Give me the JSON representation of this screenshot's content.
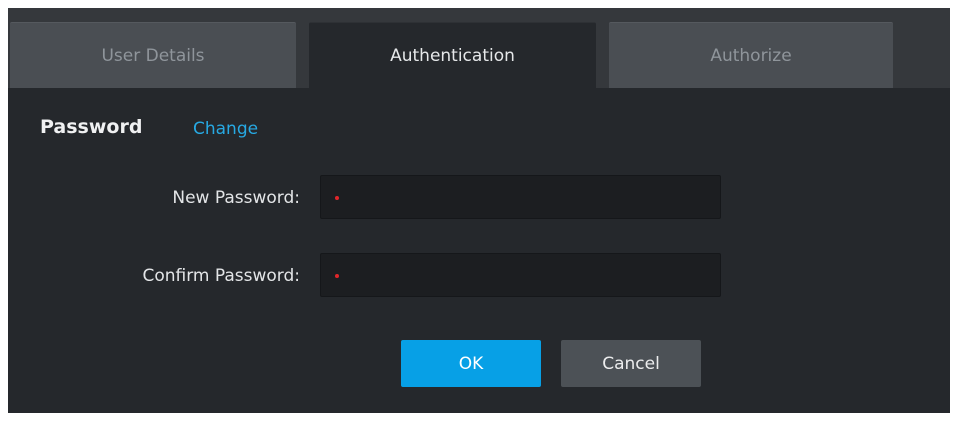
{
  "tabs": [
    {
      "label": "User Details",
      "active": false
    },
    {
      "label": "Authentication",
      "active": true
    },
    {
      "label": "Authorize",
      "active": false
    }
  ],
  "password_section": {
    "title": "Password",
    "change_link": "Change"
  },
  "fields": {
    "new_password": {
      "label": "New Password:",
      "value": "",
      "required": true
    },
    "confirm_password": {
      "label": "Confirm Password:",
      "value": "",
      "required": true
    }
  },
  "buttons": {
    "ok": "OK",
    "cancel": "Cancel"
  },
  "colors": {
    "accent": "#07a0e6",
    "link": "#27a9e3",
    "required": "#e0262a",
    "panel_bg": "#25282c"
  }
}
